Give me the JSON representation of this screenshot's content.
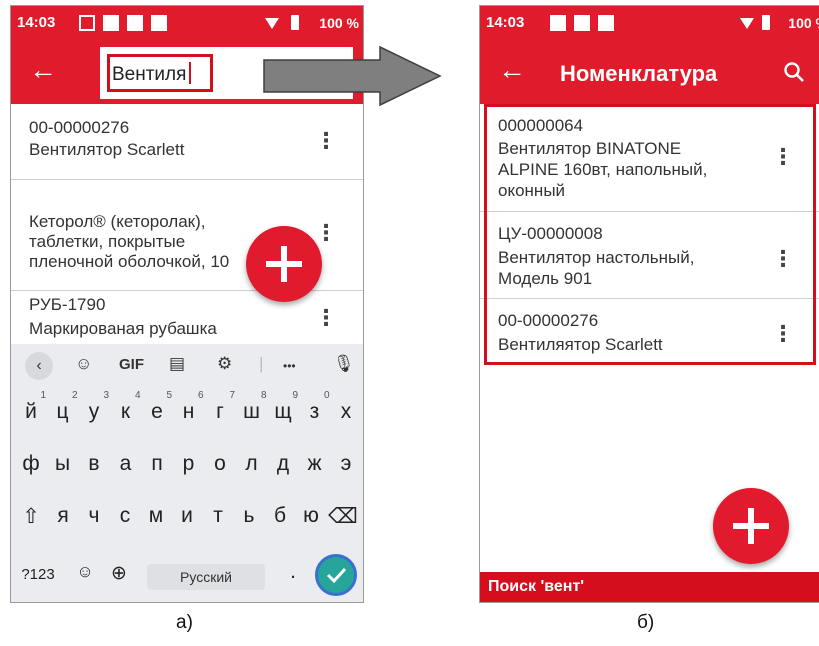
{
  "status": {
    "time": "14:03",
    "battery": "100 %"
  },
  "screen_a": {
    "search_value": "Вентиля",
    "items": [
      {
        "code": "00-00000276",
        "name": "Вентилятор Scarlett"
      },
      {
        "lines": [
          "Кеторол® (кеторолак),",
          "таблетки, покрытые",
          "пленочной оболочкой, 10"
        ]
      },
      {
        "code": "РУБ-1790",
        "name": "Маркированая рубашка"
      }
    ],
    "toolbar": {
      "back": "‹",
      "gif": "GIF",
      "more": "•••"
    },
    "keyboard": {
      "row1": [
        "й",
        "ц",
        "у",
        "к",
        "е",
        "н",
        "г",
        "ш",
        "щ",
        "з",
        "х"
      ],
      "row1_hints": [
        "1",
        "2",
        "3",
        "4",
        "5",
        "6",
        "7",
        "8",
        "9",
        "0",
        ""
      ],
      "row2": [
        "ф",
        "ы",
        "в",
        "а",
        "п",
        "р",
        "о",
        "л",
        "д",
        "ж",
        "э"
      ],
      "row3": [
        "я",
        "ч",
        "с",
        "м",
        "и",
        "т",
        "ь",
        "б",
        "ю"
      ],
      "numbers_key": "?123",
      "space_label": "Русский",
      "period": "."
    }
  },
  "screen_b": {
    "title": "Номенклатура",
    "items": [
      {
        "lines": [
          "000000064",
          "Вентилятор BINATONE",
          "ALPINE 160вт, напольный,",
          "оконный"
        ]
      },
      {
        "lines": [
          "ЦУ-00000008",
          "Вентилятор настольный,",
          "Модель 901"
        ]
      },
      {
        "lines": [
          "00-00000276",
          "Вентиляятор Scarlett"
        ]
      }
    ],
    "bottom_status": "Поиск 'вент'"
  },
  "captions": {
    "a": "а)",
    "b": "б)"
  },
  "colors": {
    "accent": "#e01b2c",
    "highlight": "#d40e1c",
    "arrow": "#7f7f7f"
  }
}
